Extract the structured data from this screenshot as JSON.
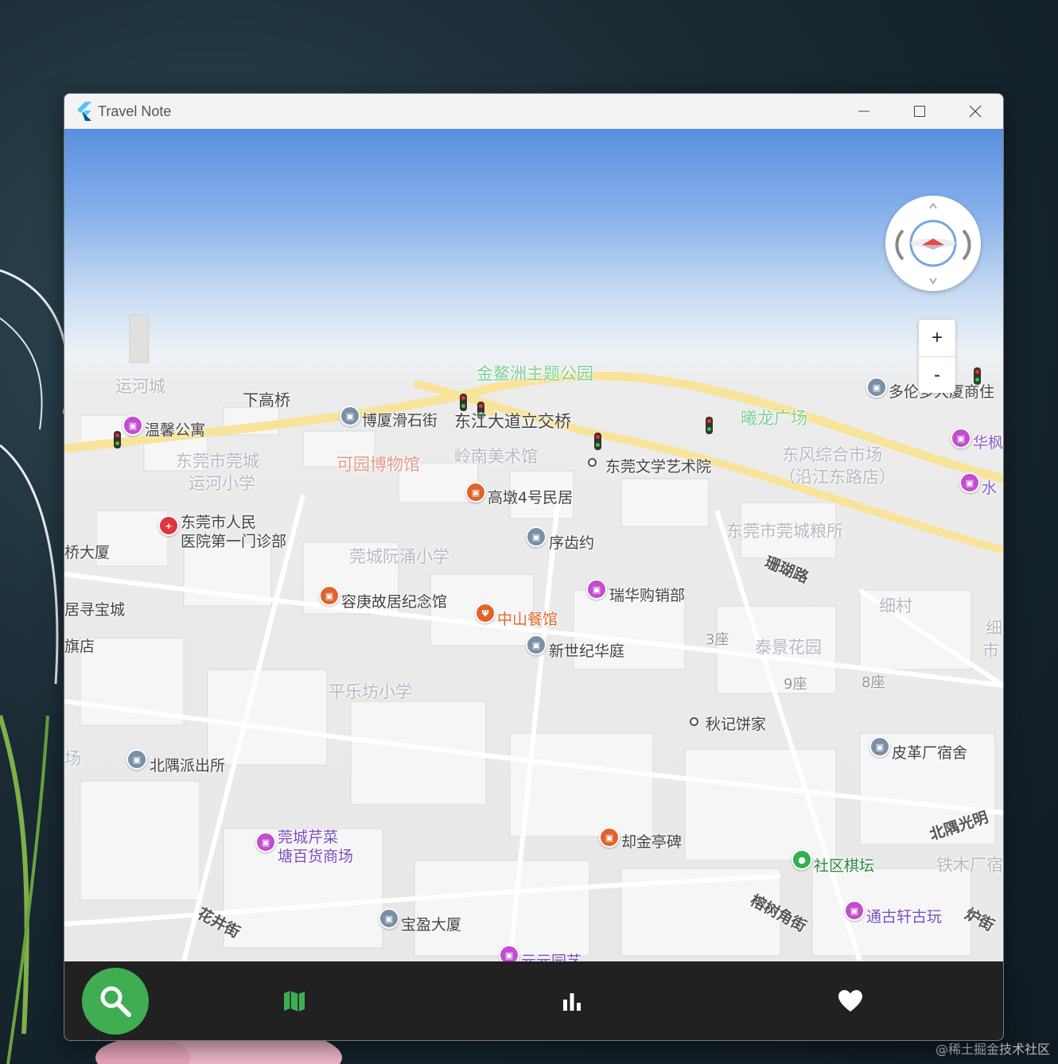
{
  "window": {
    "title": "Travel Note"
  },
  "watermark": "@稀土掘金技术社区",
  "map": {
    "labels": [
      {
        "text": "金鳌洲主题公园"
      },
      {
        "text": "运河城"
      },
      {
        "text": "下高桥"
      },
      {
        "text": "温馨公寓"
      },
      {
        "text": "博厦滑石街"
      },
      {
        "text": "东江大道立交桥"
      },
      {
        "text": "曦龙广场"
      },
      {
        "text": "多伦多大厦商住"
      },
      {
        "text": "华枫"
      },
      {
        "text": "东莞市莞城"
      },
      {
        "text": "运河小学"
      },
      {
        "text": "可园博物馆"
      },
      {
        "text": "岭南美术馆"
      },
      {
        "text": "东莞文学艺术院"
      },
      {
        "text": "东风综合市场"
      },
      {
        "text": "（沿江东路店）"
      },
      {
        "text": "水"
      },
      {
        "text": "高墩4号民居"
      },
      {
        "text": "东莞市人民"
      },
      {
        "text": "医院第一门诊部"
      },
      {
        "text": "序齿约"
      },
      {
        "text": "东莞市莞城粮所"
      },
      {
        "text": "桥大厦"
      },
      {
        "text": "莞城阮涌小学"
      },
      {
        "text": "珊瑚路"
      },
      {
        "text": "细村"
      },
      {
        "text": "细"
      },
      {
        "text": "市"
      },
      {
        "text": "居寻宝城"
      },
      {
        "text": "容庚故居纪念馆"
      },
      {
        "text": "瑞华购销部"
      },
      {
        "text": "中山餐馆"
      },
      {
        "text": "旗店"
      },
      {
        "text": "新世纪华庭"
      },
      {
        "text": "3座"
      },
      {
        "text": "泰景花园"
      },
      {
        "text": "9座"
      },
      {
        "text": "8座"
      },
      {
        "text": "平乐坊小学"
      },
      {
        "text": "秋记饼家"
      },
      {
        "text": "场"
      },
      {
        "text": "北隅派出所"
      },
      {
        "text": "皮革厂宿舍"
      },
      {
        "text": "北隅光明"
      },
      {
        "text": "莞城芹菜"
      },
      {
        "text": "塘百货商场"
      },
      {
        "text": "却金亭碑"
      },
      {
        "text": "社区棋坛"
      },
      {
        "text": "铁木厂宿"
      },
      {
        "text": "榕树角街"
      },
      {
        "text": "通古轩古玩"
      },
      {
        "text": "炉街"
      },
      {
        "text": "花井街"
      },
      {
        "text": "宝盈大厦"
      },
      {
        "text": "元元园艺"
      }
    ],
    "zoom_in": "+",
    "zoom_out": "-"
  },
  "nav": {
    "items": [
      {
        "icon": "search-icon",
        "active": true
      },
      {
        "icon": "map-icon",
        "active": false
      },
      {
        "icon": "bar-chart-icon",
        "active": false
      },
      {
        "icon": "heart-icon",
        "active": false
      }
    ]
  },
  "colors": {
    "accent": "#3fae53",
    "nav_bg": "#212121",
    "titlebar_bg": "#f3f3f3"
  }
}
